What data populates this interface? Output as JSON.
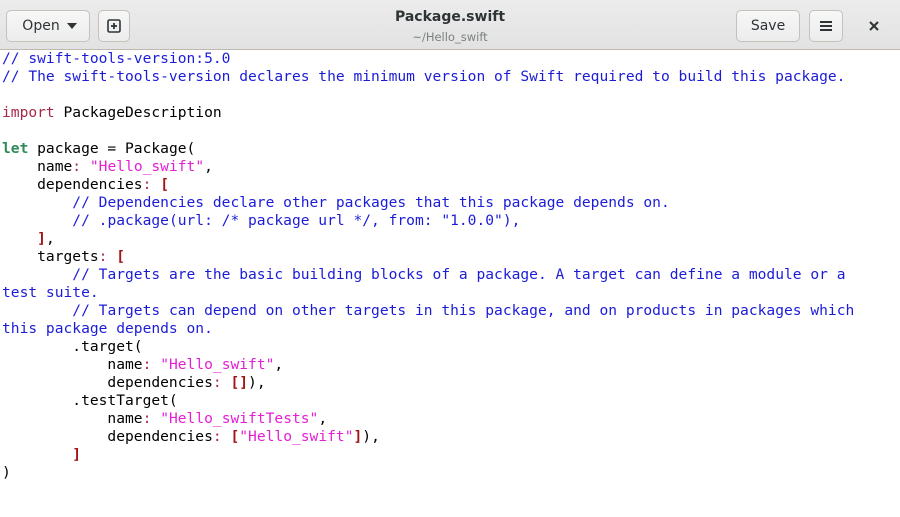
{
  "window": {
    "title": "Package.swift",
    "subtitle": "~/Hello_swift"
  },
  "header": {
    "open_label": "Open",
    "save_label": "Save",
    "icons": {
      "open_arrow": "chevron-down-icon",
      "new_tab": "new-document-icon",
      "menu": "hamburger-menu-icon",
      "close": "close-icon"
    }
  },
  "editor": {
    "lines": [
      [
        {
          "t": "c",
          "v": "// swift-tools-version:5.0"
        }
      ],
      [
        {
          "t": "c",
          "v": "// The swift-tools-version declares the minimum version of Swift required to build this package."
        }
      ],
      [],
      [
        {
          "t": "k",
          "v": "import"
        },
        {
          "t": "p",
          "v": " PackageDescription"
        }
      ],
      [],
      [
        {
          "t": "kl",
          "v": "let"
        },
        {
          "t": "p",
          "v": " package = Package("
        }
      ],
      [
        {
          "t": "p",
          "v": "    name"
        },
        {
          "t": "k",
          "v": ":"
        },
        {
          "t": "p",
          "v": " "
        },
        {
          "t": "s",
          "v": "\"Hello_swift\""
        },
        {
          "t": "p",
          "v": ","
        }
      ],
      [
        {
          "t": "p",
          "v": "    dependencies"
        },
        {
          "t": "k",
          "v": ":"
        },
        {
          "t": "p",
          "v": " "
        },
        {
          "t": "b",
          "v": "["
        }
      ],
      [
        {
          "t": "p",
          "v": "        "
        },
        {
          "t": "c",
          "v": "// Dependencies declare other packages that this package depends on."
        }
      ],
      [
        {
          "t": "p",
          "v": "        "
        },
        {
          "t": "c",
          "v": "// .package(url: /* package url */, from: \"1.0.0\"),"
        }
      ],
      [
        {
          "t": "p",
          "v": "    "
        },
        {
          "t": "b",
          "v": "]"
        },
        {
          "t": "p",
          "v": ","
        }
      ],
      [
        {
          "t": "p",
          "v": "    targets"
        },
        {
          "t": "k",
          "v": ":"
        },
        {
          "t": "p",
          "v": " "
        },
        {
          "t": "b",
          "v": "["
        }
      ],
      [
        {
          "t": "p",
          "v": "        "
        },
        {
          "t": "c",
          "v": "// Targets are the basic building blocks of a package. A target can define a module or a"
        }
      ],
      [
        {
          "t": "c",
          "v": "test suite."
        }
      ],
      [
        {
          "t": "p",
          "v": "        "
        },
        {
          "t": "c",
          "v": "// Targets can depend on other targets in this package, and on products in packages which"
        }
      ],
      [
        {
          "t": "c",
          "v": "this package depends on."
        }
      ],
      [
        {
          "t": "p",
          "v": "        .target("
        }
      ],
      [
        {
          "t": "p",
          "v": "            name"
        },
        {
          "t": "k",
          "v": ":"
        },
        {
          "t": "p",
          "v": " "
        },
        {
          "t": "s",
          "v": "\"Hello_swift\""
        },
        {
          "t": "p",
          "v": ","
        }
      ],
      [
        {
          "t": "p",
          "v": "            dependencies"
        },
        {
          "t": "k",
          "v": ":"
        },
        {
          "t": "p",
          "v": " "
        },
        {
          "t": "b",
          "v": "[]"
        },
        {
          "t": "p",
          "v": "),"
        }
      ],
      [
        {
          "t": "p",
          "v": "        .testTarget("
        }
      ],
      [
        {
          "t": "p",
          "v": "            name"
        },
        {
          "t": "k",
          "v": ":"
        },
        {
          "t": "p",
          "v": " "
        },
        {
          "t": "s",
          "v": "\"Hello_swiftTests\""
        },
        {
          "t": "p",
          "v": ","
        }
      ],
      [
        {
          "t": "p",
          "v": "            dependencies"
        },
        {
          "t": "k",
          "v": ":"
        },
        {
          "t": "p",
          "v": " "
        },
        {
          "t": "b",
          "v": "["
        },
        {
          "t": "s",
          "v": "\"Hello_swift\""
        },
        {
          "t": "b",
          "v": "]"
        },
        {
          "t": "p",
          "v": "),"
        }
      ],
      [
        {
          "t": "p",
          "v": "        "
        },
        {
          "t": "b",
          "v": "]"
        }
      ],
      [
        {
          "t": "p",
          "v": ")"
        }
      ]
    ]
  },
  "colors": {
    "comment": "#1c1cd8",
    "string": "#e41fd6",
    "keyword": "#a52a4a",
    "keyword_let": "#2e8b57",
    "bracket": "#a31515"
  }
}
